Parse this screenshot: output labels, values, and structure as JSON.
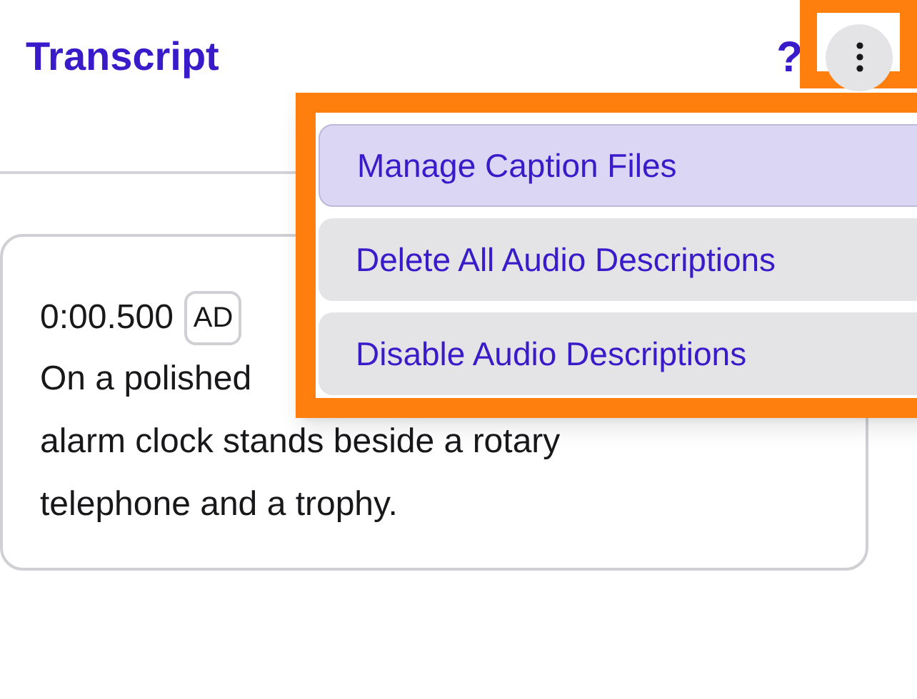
{
  "header": {
    "title": "Transcript",
    "help": "?"
  },
  "menu": {
    "open": true,
    "items": [
      {
        "label": "Manage Caption Files",
        "selected": true
      },
      {
        "label": "Delete All Audio Descriptions",
        "selected": false
      },
      {
        "label": "Disable Audio Descriptions",
        "selected": false
      }
    ]
  },
  "entries": [
    {
      "time": "0:00.500",
      "badge": "AD",
      "lines": [
        "On a polished",
        "alarm clock stands beside a rotary",
        "telephone and a trophy."
      ]
    }
  ]
}
